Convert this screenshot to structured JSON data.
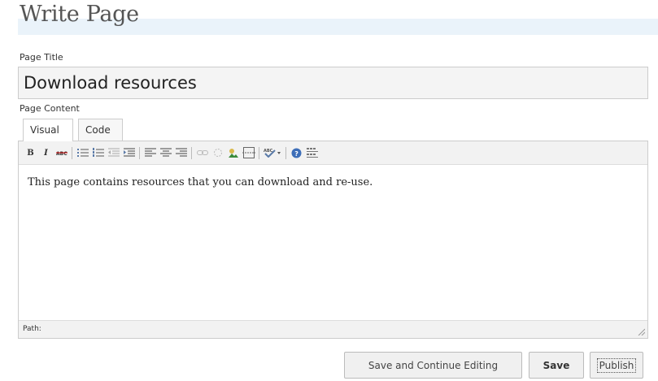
{
  "page": {
    "heading": "Write Page"
  },
  "title_field": {
    "label": "Page Title",
    "value": "Download resources"
  },
  "content_field": {
    "label": "Page Content",
    "tabs": [
      "Visual",
      "Code"
    ],
    "active_tab": "Visual",
    "toolbar": [
      {
        "icon": "bold-icon",
        "glyph": "B"
      },
      {
        "icon": "italic-icon",
        "glyph": "I"
      },
      {
        "icon": "strikethrough-icon",
        "glyph": "ABC"
      },
      {
        "icon": "bullet-list-icon"
      },
      {
        "icon": "numbered-list-icon"
      },
      {
        "icon": "outdent-icon"
      },
      {
        "icon": "indent-icon"
      },
      {
        "icon": "align-left-icon"
      },
      {
        "icon": "align-center-icon"
      },
      {
        "icon": "align-right-icon"
      },
      {
        "icon": "link-icon"
      },
      {
        "icon": "unlink-icon"
      },
      {
        "icon": "image-icon"
      },
      {
        "icon": "more-break-icon"
      },
      {
        "icon": "spellcheck-icon"
      },
      {
        "icon": "help-icon"
      },
      {
        "icon": "kitchen-sink-icon"
      }
    ],
    "body_text": "This page contains resources that you can download and re-use.",
    "path_label": "Path:"
  },
  "actions": {
    "save_continue": "Save and Continue Editing",
    "save": "Save",
    "publish": "Publish"
  },
  "colors": {
    "heading_band": "#eaf3fa",
    "input_bg": "#f4f4f4",
    "toolbar_bg": "#f2f2f2",
    "button_bg": "#f0f0f0"
  }
}
